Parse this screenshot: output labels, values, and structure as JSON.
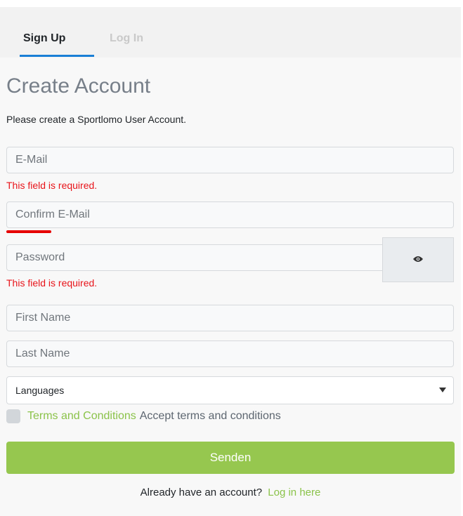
{
  "tabs": [
    {
      "label": "Sign Up",
      "active": true
    },
    {
      "label": "Log In",
      "active": false
    }
  ],
  "form": {
    "title": "Create Account",
    "subtitle": "Please create a Sportlomo User Account.",
    "email": {
      "placeholder": "E-Mail",
      "value": "",
      "error": "This field is required."
    },
    "confirm_email": {
      "placeholder": "Confirm E-Mail",
      "value": ""
    },
    "password": {
      "placeholder": "Password",
      "value": "",
      "error": "This field is required."
    },
    "first_name": {
      "placeholder": "First Name",
      "value": ""
    },
    "last_name": {
      "placeholder": "Last Name",
      "value": ""
    },
    "languages": {
      "selected": "Languages"
    },
    "terms": {
      "link_label": "Terms and Conditions",
      "text": "Accept terms and conditions",
      "checked": false
    },
    "submit_label": "Senden"
  },
  "footer": {
    "text": "Already have an account?",
    "link_label": "Log in here"
  },
  "icons": {
    "password_toggle": "eye-icon",
    "select_arrow": "caret-down-icon"
  },
  "colors": {
    "accent": "#1a7fd6",
    "error": "#e8141a",
    "success": "#96c74f",
    "link": "#8bc34a"
  }
}
